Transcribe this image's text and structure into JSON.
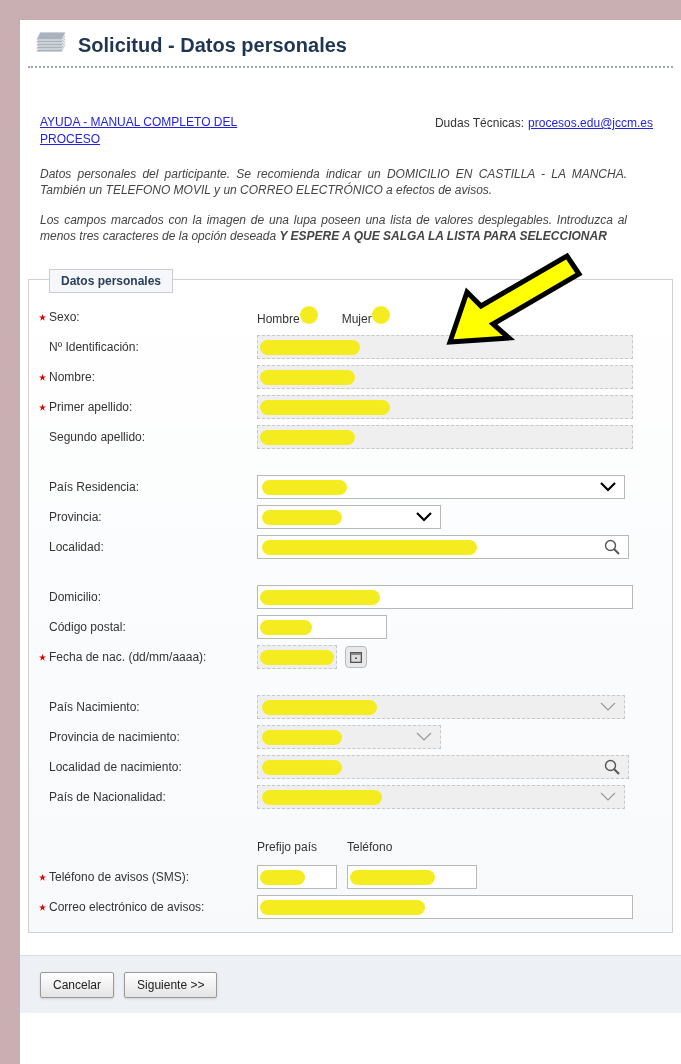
{
  "header": {
    "title": "Solicitud - Datos personales"
  },
  "help_link": "AYUDA - MANUAL COMPLETO DEL PROCESO",
  "contact": {
    "label": "Dudas Técnicas:",
    "email": "procesos.edu@jccm.es"
  },
  "notes": [
    "Datos personales del participante. Se recomienda indicar un DOMICILIO EN CASTILLA - LA MANCHA. También un TELEFONO MOVIL y un CORREO ELECTRÓNICO a efectos de avisos.",
    "Los campos marcados con la imagen de una lupa poseen una lista de valores desplegables. Introduzca al menos tres caracteres de la opción deseada **Y ESPERE A QUE SALGA LA LISTA PARA SELECCIONAR**"
  ],
  "fieldset": {
    "legend": "Datos personales",
    "groups": [
      [
        {
          "kind": "radio",
          "label": "Sexo:",
          "required": true,
          "options": [
            "Hombre",
            "Mujer"
          ]
        },
        {
          "kind": "text",
          "label": "Nº Identificación:",
          "required": false,
          "disabled": true
        },
        {
          "kind": "text",
          "label": "Nombre:",
          "required": true,
          "disabled": true
        },
        {
          "kind": "text",
          "label": "Primer apellido:",
          "required": true,
          "disabled": true
        },
        {
          "kind": "text",
          "label": "Segundo apellido:",
          "required": false,
          "disabled": true
        }
      ],
      [
        {
          "kind": "select",
          "label": "País Residencia:",
          "required": false,
          "disabled": false
        },
        {
          "kind": "shortselect",
          "label": "Provincia:",
          "required": false,
          "disabled": false
        },
        {
          "kind": "lookup",
          "label": "Localidad:",
          "required": false,
          "disabled": false
        }
      ],
      [
        {
          "kind": "text",
          "label": "Domicilio:",
          "required": false,
          "disabled": false
        },
        {
          "kind": "shorttext",
          "label": "Código postal:",
          "required": false,
          "disabled": false
        },
        {
          "kind": "date",
          "label": "Fecha de nac. (dd/mm/aaaa):",
          "required": true,
          "disabled": true
        }
      ],
      [
        {
          "kind": "select",
          "label": "País Nacimiento:",
          "required": false,
          "disabled": true
        },
        {
          "kind": "shortselect",
          "label": "Provincia de nacimiento:",
          "required": false,
          "disabled": true
        },
        {
          "kind": "lookup",
          "label": "Localidad de nacimiento:",
          "required": false,
          "disabled": true
        },
        {
          "kind": "select",
          "label": "País de Nacionalidad:",
          "required": false,
          "disabled": true
        }
      ],
      [
        {
          "kind": "headers",
          "labels": [
            "Prefijo país",
            "Teléfono"
          ]
        },
        {
          "kind": "phone",
          "label": "Teléfono de avisos (SMS):",
          "required": true,
          "disabled": false
        },
        {
          "kind": "text",
          "label": "Correo electrónico de avisos:",
          "required": true,
          "disabled": false
        }
      ]
    ]
  },
  "buttons": [
    "Cancelar",
    "Siguiente >>"
  ]
}
